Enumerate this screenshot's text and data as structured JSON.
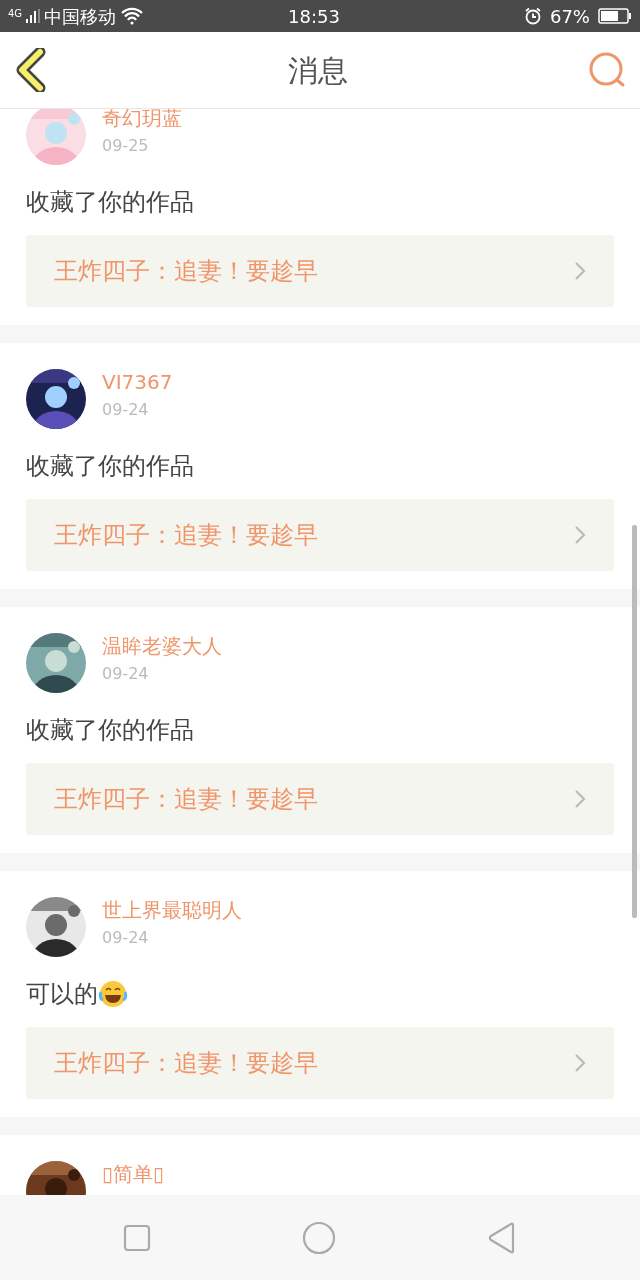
{
  "status_bar": {
    "network": "4G",
    "carrier": "中国移动",
    "time": "18:53",
    "battery": "67%"
  },
  "header": {
    "title": "消息"
  },
  "messages": [
    {
      "kind": "plain",
      "user": "奇幻玥蓝",
      "date": "09-25",
      "text": "收藏了你的作品",
      "work": "王炸四子：追妻！要趁早"
    },
    {
      "kind": "plain",
      "user": "VI7367",
      "date": "09-24",
      "text": "收藏了你的作品",
      "work": "王炸四子：追妻！要趁早"
    },
    {
      "kind": "plain",
      "user": "温眸老婆大人",
      "date": "09-24",
      "text": "收藏了你的作品",
      "work": "王炸四子：追妻！要趁早"
    },
    {
      "kind": "laughing",
      "user": "世上界最聪明人",
      "date": "09-24",
      "text": "可以的",
      "work": "王炸四子：追妻！要趁早"
    },
    {
      "user": "▯简单▯"
    }
  ]
}
